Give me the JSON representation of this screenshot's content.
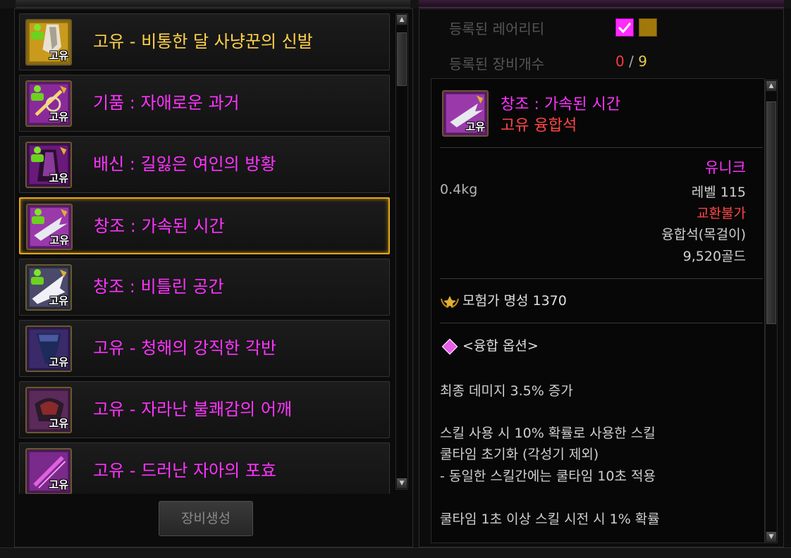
{
  "item_list": {
    "items": [
      {
        "name": "고유 - 비통한 달 사냥꾼의 신발",
        "tag": "고유",
        "color": "#ffd24a",
        "selected": false
      },
      {
        "name": "기품 : 자애로운 과거",
        "tag": "고유",
        "color": "#ff33ff",
        "selected": false
      },
      {
        "name": "배신 : 길잃은 여인의 방황",
        "tag": "고유",
        "color": "#ff33ff",
        "selected": false
      },
      {
        "name": "창조 : 가속된 시간",
        "tag": "고유",
        "color": "#ff33ff",
        "selected": true
      },
      {
        "name": "창조 : 비틀린 공간",
        "tag": "고유",
        "color": "#ff33ff",
        "selected": false
      },
      {
        "name": "고유 - 청해의 강직한 각반",
        "tag": "고유",
        "color": "#ff33ff",
        "selected": false
      },
      {
        "name": "고유 - 자라난 불쾌감의 어깨",
        "tag": "고유",
        "color": "#ff33ff",
        "selected": false
      },
      {
        "name": "고유 - 드러난 자아의 포효",
        "tag": "고유",
        "color": "#ff33ff",
        "selected": false
      }
    ],
    "generate_button": "장비생성"
  },
  "registration": {
    "rarity_label": "등록된 레어리티",
    "count_label": "등록된 장비개수",
    "count_current": "0",
    "count_sep": "/",
    "count_max": "9",
    "rarity_checked_color": "#ff2bff",
    "rarity_unchecked_color": "#a0780c"
  },
  "tooltip": {
    "name": "창조 : 가속된 시간",
    "icon_tag": "고유",
    "subtitle": "고유 융합석",
    "weight": "0.4kg",
    "rarity": "유니크",
    "level": "레벨 115",
    "trade": "교환불가",
    "type": "융합석(목걸이)",
    "price": "9,520골드",
    "fame": "모험가 명성 1370",
    "fusion_header": "<융합 옵션>",
    "options": [
      "최종 데미지 3.5% 증가",
      "스킬 사용 시 10% 확률로 사용한 스킬",
      "쿨타임 초기화 (각성기 제외)",
      "- 동일한 스킬간에는 쿨타임 10초 적용",
      "쿨타임 1초 이상 스킬 시전 시 1% 확률"
    ]
  }
}
